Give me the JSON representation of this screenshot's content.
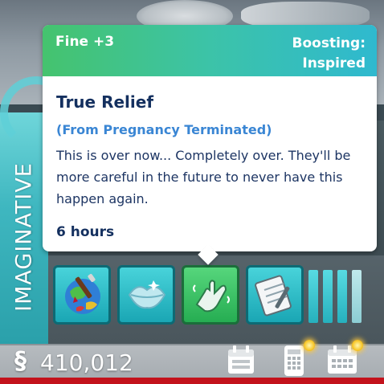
{
  "emotion": {
    "label": "IMAGINATIVE"
  },
  "tooltip": {
    "mood": "Fine +3",
    "boosting_line1": "Boosting:",
    "boosting_line2": "Inspired",
    "title": "True Relief",
    "source": "(From Pregnancy Terminated)",
    "description": "This is over now... Completely over. They'll be more careful in the future to never have this happen again.",
    "duration": "6 hours"
  },
  "moodlets": [
    {
      "icon": "paintbrush-globe-icon",
      "color": "teal"
    },
    {
      "icon": "lips-icon",
      "color": "teal"
    },
    {
      "icon": "hand-gesture-icon",
      "color": "green",
      "selected": true
    },
    {
      "icon": "notepad-icon",
      "color": "teal"
    }
  ],
  "funds": {
    "value": "410,012",
    "currency_symbol": "§"
  },
  "colors": {
    "header_gradient": [
      "#45c36e",
      "#2fb9cf"
    ],
    "title": "#14305f",
    "source": "#3a86d4",
    "moodlet_teal": "#1aa6b4",
    "moodlet_green": "#26ad52",
    "footer_red": "#c3121c"
  }
}
